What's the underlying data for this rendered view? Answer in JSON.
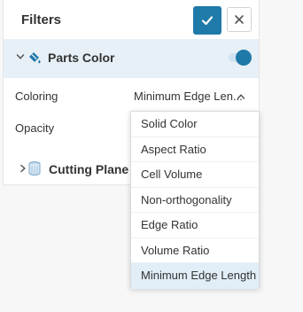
{
  "header": {
    "title": "Filters"
  },
  "icons": {
    "confirm": "check-icon",
    "close": "close-icon",
    "expand": "chevron-down-icon",
    "collapse": "chevron-right-icon",
    "paint": "paint-bucket-icon",
    "dropdown_caret": "chevron-up-icon",
    "cutting_plane": "cylinder-icon"
  },
  "colors": {
    "accent": "#1f79a9",
    "selected_row": "#e7f0f7"
  },
  "sections": {
    "parts_color": {
      "label": "Parts Color",
      "enabled": true,
      "coloring": {
        "label": "Coloring",
        "value": "Minimum Edge Len..."
      },
      "opacity": {
        "label": "Opacity"
      }
    },
    "cutting_plane": {
      "label": "Cutting Plane 1"
    }
  },
  "dropdown": {
    "options": [
      "Solid Color",
      "Aspect Ratio",
      "Cell Volume",
      "Non-orthogonality",
      "Edge Ratio",
      "Volume Ratio",
      "Minimum Edge Length"
    ],
    "selected": "Minimum Edge Length"
  }
}
